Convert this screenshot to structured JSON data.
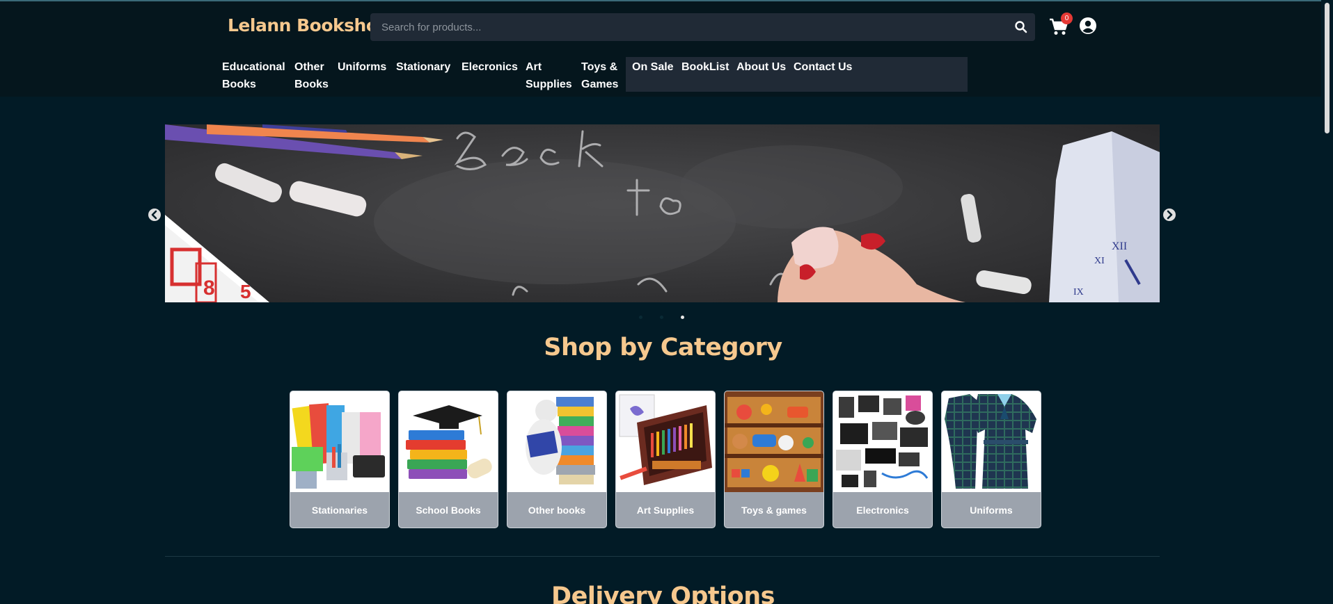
{
  "header": {
    "logo": "Lelann Bookshop",
    "search_placeholder": "Search for products...",
    "cart_count": "0"
  },
  "nav": {
    "items": [
      {
        "label": "Educational Books"
      },
      {
        "label": "Other Books"
      },
      {
        "label": "Uniforms"
      },
      {
        "label": "Stationary"
      },
      {
        "label": "Elecronics"
      },
      {
        "label": "Art Supplies"
      },
      {
        "label": "Toys & Games"
      }
    ],
    "links": [
      {
        "label": "On Sale"
      },
      {
        "label": "BookList"
      },
      {
        "label": "About Us"
      },
      {
        "label": "Contact Us"
      }
    ]
  },
  "carousel": {
    "active_slide": 3,
    "slide_count": 3
  },
  "categories": {
    "title": "Shop by Category",
    "items": [
      {
        "label": "Stationaries",
        "icon": "stationery-image"
      },
      {
        "label": "School Books",
        "icon": "school-books-image"
      },
      {
        "label": "Other books",
        "icon": "other-books-image"
      },
      {
        "label": "Art Supplies",
        "icon": "art-supplies-image"
      },
      {
        "label": "Toys & games",
        "icon": "toys-image"
      },
      {
        "label": "Electronics",
        "icon": "electronics-image"
      },
      {
        "label": "Uniforms",
        "icon": "uniforms-image"
      }
    ]
  },
  "delivery": {
    "title": "Delivery Options"
  },
  "colors": {
    "background": "#021b26",
    "header": "#05161d",
    "accent": "#f6c88e",
    "search_bg": "#202a36",
    "card_label": "#9ca3ad",
    "badge": "#e53935"
  }
}
